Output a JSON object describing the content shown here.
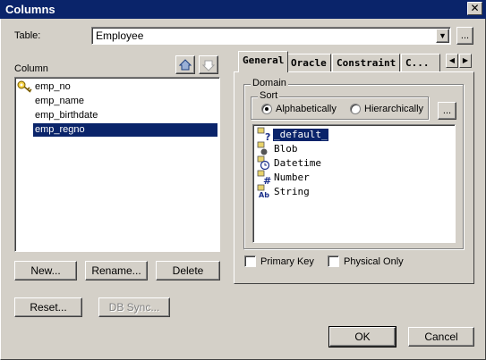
{
  "window": {
    "title": "Columns",
    "close_symbol": "✕"
  },
  "table_field": {
    "label": "Table:",
    "value": "Employee",
    "browse_label": "..."
  },
  "column_panel": {
    "label": "Column",
    "items": [
      {
        "name": "emp_no",
        "icon": "key-icon",
        "selected": false
      },
      {
        "name": "emp_name",
        "icon": "",
        "selected": false
      },
      {
        "name": "emp_birthdate",
        "icon": "",
        "selected": false
      },
      {
        "name": "emp_regno",
        "icon": "",
        "selected": true
      }
    ],
    "buttons": {
      "new": "New...",
      "rename": "Rename...",
      "delete": "Delete",
      "reset": "Reset...",
      "db_sync": "DB Sync..."
    }
  },
  "tabs": [
    {
      "label": "General",
      "active": true
    },
    {
      "label": "Oracle",
      "active": false
    },
    {
      "label": "Constraint",
      "active": false
    },
    {
      "label": "C...",
      "active": false
    }
  ],
  "general": {
    "domain_group": "Domain",
    "sort_group": "Sort",
    "sort_options": {
      "alphabetically": "Alphabetically",
      "hierarchically": "Hierarchically",
      "selected": "alphabetically"
    },
    "sort_browse_label": "...",
    "domains": [
      {
        "name": "_default_",
        "icon": "question-icon",
        "selected": true
      },
      {
        "name": "Blob",
        "icon": "blob-icon",
        "selected": false
      },
      {
        "name": "Datetime",
        "icon": "clock-icon",
        "selected": false
      },
      {
        "name": "Number",
        "icon": "hash-icon",
        "selected": false
      },
      {
        "name": "String",
        "icon": "string-icon",
        "selected": false
      }
    ],
    "primary_key": {
      "label": "Primary Key",
      "checked": false
    },
    "physical_only": {
      "label": "Physical Only",
      "checked": false
    }
  },
  "footer": {
    "ok": "OK",
    "cancel": "Cancel"
  },
  "colors": {
    "titlebar": "#0a246a",
    "face": "#d4d0c8",
    "selection": "#0a246a"
  }
}
